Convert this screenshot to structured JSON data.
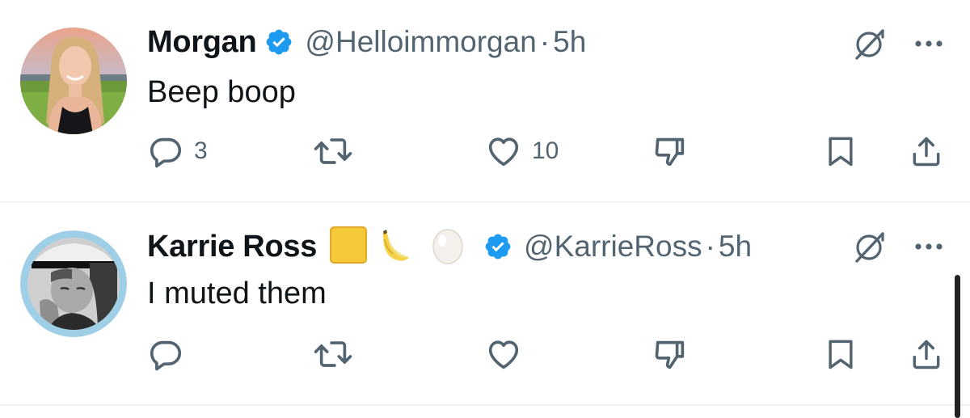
{
  "tweets": [
    {
      "author_name": "Morgan",
      "verified": true,
      "handle": "@Helloimmorgan",
      "separator": "·",
      "time": "5h",
      "text": "Beep boop",
      "reply_count": "3",
      "retweet_count": "",
      "like_count": "10"
    },
    {
      "author_name": "Karrie Ross",
      "name_emojis": [
        "yellow-square",
        "banana",
        "egg"
      ],
      "verified": true,
      "handle": "@KarrieRoss",
      "separator": "·",
      "time": "5h",
      "text": "I muted them",
      "reply_count": "",
      "retweet_count": "",
      "like_count": ""
    }
  ],
  "icons": {
    "reply": "reply-icon",
    "retweet": "retweet-icon",
    "like": "heart-icon",
    "dislike": "thumbs-down-icon",
    "bookmark": "bookmark-icon",
    "share": "share-icon",
    "grok": "grok-icon",
    "more": "more-icon",
    "verified": "verified-badge-icon"
  },
  "colors": {
    "text": "#0f1419",
    "secondary": "#536471",
    "verified": "#1d9bf0",
    "divider": "#eff3f4"
  }
}
